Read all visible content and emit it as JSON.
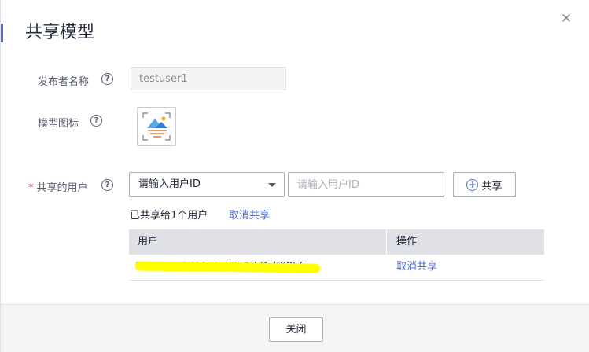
{
  "dialog": {
    "title": "共享模型",
    "close_icon": "close-icon"
  },
  "form": {
    "publisher": {
      "label": "发布者名称",
      "value": "testuser1"
    },
    "model_icon": {
      "label": "模型图标",
      "icon": "model-landscape-icon"
    },
    "shared_users": {
      "required_mark": "*",
      "label": "共享的用户",
      "select_value": "请输入用户ID",
      "input_placeholder": "请输入用户ID",
      "share_button": "共享"
    }
  },
  "shared_summary": {
    "text": "已共享给1个用户",
    "cancel_all_link": "取消共享"
  },
  "table": {
    "columns": [
      "用户",
      "操作"
    ],
    "rows": [
      {
        "user_id": "fde3f88d0d33c3cd4c9dd1df98bf",
        "action": "取消共享"
      }
    ]
  },
  "footer": {
    "close_button": "关闭"
  },
  "colors": {
    "accent": "#526ecc",
    "required": "#ee3b3b",
    "redaction": "#ffff00"
  }
}
